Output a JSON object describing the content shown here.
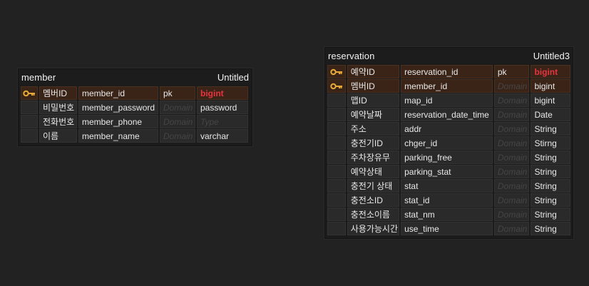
{
  "colors": {
    "background": "#222222",
    "pk_row": "#3a2417",
    "pk_type": "#e8343f",
    "key_icon": "#e7a93a"
  },
  "entities": {
    "member": {
      "name": "member",
      "schema": "Untitled",
      "rows": [
        {
          "key": true,
          "logical": "멤버ID",
          "physical": "member_id",
          "domain": "pk",
          "type": "bigint",
          "domain_placeholder": false,
          "type_pk": true
        },
        {
          "key": false,
          "logical": "비밀번호",
          "physical": "member_password",
          "domain": "Domain",
          "type": "password",
          "domain_placeholder": true,
          "type_pk": false
        },
        {
          "key": false,
          "logical": "전화번호",
          "physical": "member_phone",
          "domain": "Domain",
          "type": "Type",
          "domain_placeholder": true,
          "type_placeholder": true
        },
        {
          "key": false,
          "logical": "이름",
          "physical": "member_name",
          "domain": "Domain",
          "type": "varchar",
          "domain_placeholder": true,
          "type_pk": false
        }
      ]
    },
    "reservation": {
      "name": "reservation",
      "schema": "Untitled3",
      "rows": [
        {
          "key": true,
          "logical": "예약ID",
          "physical": "reservation_id",
          "domain": "pk",
          "type": "bigint",
          "domain_placeholder": false,
          "type_pk": true
        },
        {
          "key": true,
          "logical": "멤버ID",
          "physical": "member_id",
          "domain": "Domain",
          "type": "bigint",
          "domain_placeholder": true,
          "type_pk": false
        },
        {
          "key": false,
          "logical": "맵ID",
          "physical": "map_id",
          "domain": "Domain",
          "type": "bigint",
          "domain_placeholder": true
        },
        {
          "key": false,
          "logical": "예약날짜",
          "physical": "reservation_date_time",
          "domain": "Domain",
          "type": "Date",
          "domain_placeholder": true
        },
        {
          "key": false,
          "logical": "주소",
          "physical": "addr",
          "domain": "Domain",
          "type": "String",
          "domain_placeholder": true
        },
        {
          "key": false,
          "logical": "충전기ID",
          "physical": "chger_id",
          "domain": "Domain",
          "type": "Stirng",
          "domain_placeholder": true
        },
        {
          "key": false,
          "logical": "주차장유무",
          "physical": "parking_free",
          "domain": "Domain",
          "type": "String",
          "domain_placeholder": true
        },
        {
          "key": false,
          "logical": "예약상태",
          "physical": "parking_stat",
          "domain": "Domain",
          "type": "String",
          "domain_placeholder": true
        },
        {
          "key": false,
          "logical": "충전기 상태",
          "physical": "stat",
          "domain": "Domain",
          "type": "String",
          "domain_placeholder": true
        },
        {
          "key": false,
          "logical": "충전소ID",
          "physical": "stat_id",
          "domain": "Domain",
          "type": "String",
          "domain_placeholder": true
        },
        {
          "key": false,
          "logical": "충전소이름",
          "physical": "stat_nm",
          "domain": "Domain",
          "type": "String",
          "domain_placeholder": true
        },
        {
          "key": false,
          "logical": "사용가능시간",
          "physical": "use_time",
          "domain": "Domain",
          "type": "String",
          "domain_placeholder": true
        }
      ]
    }
  }
}
